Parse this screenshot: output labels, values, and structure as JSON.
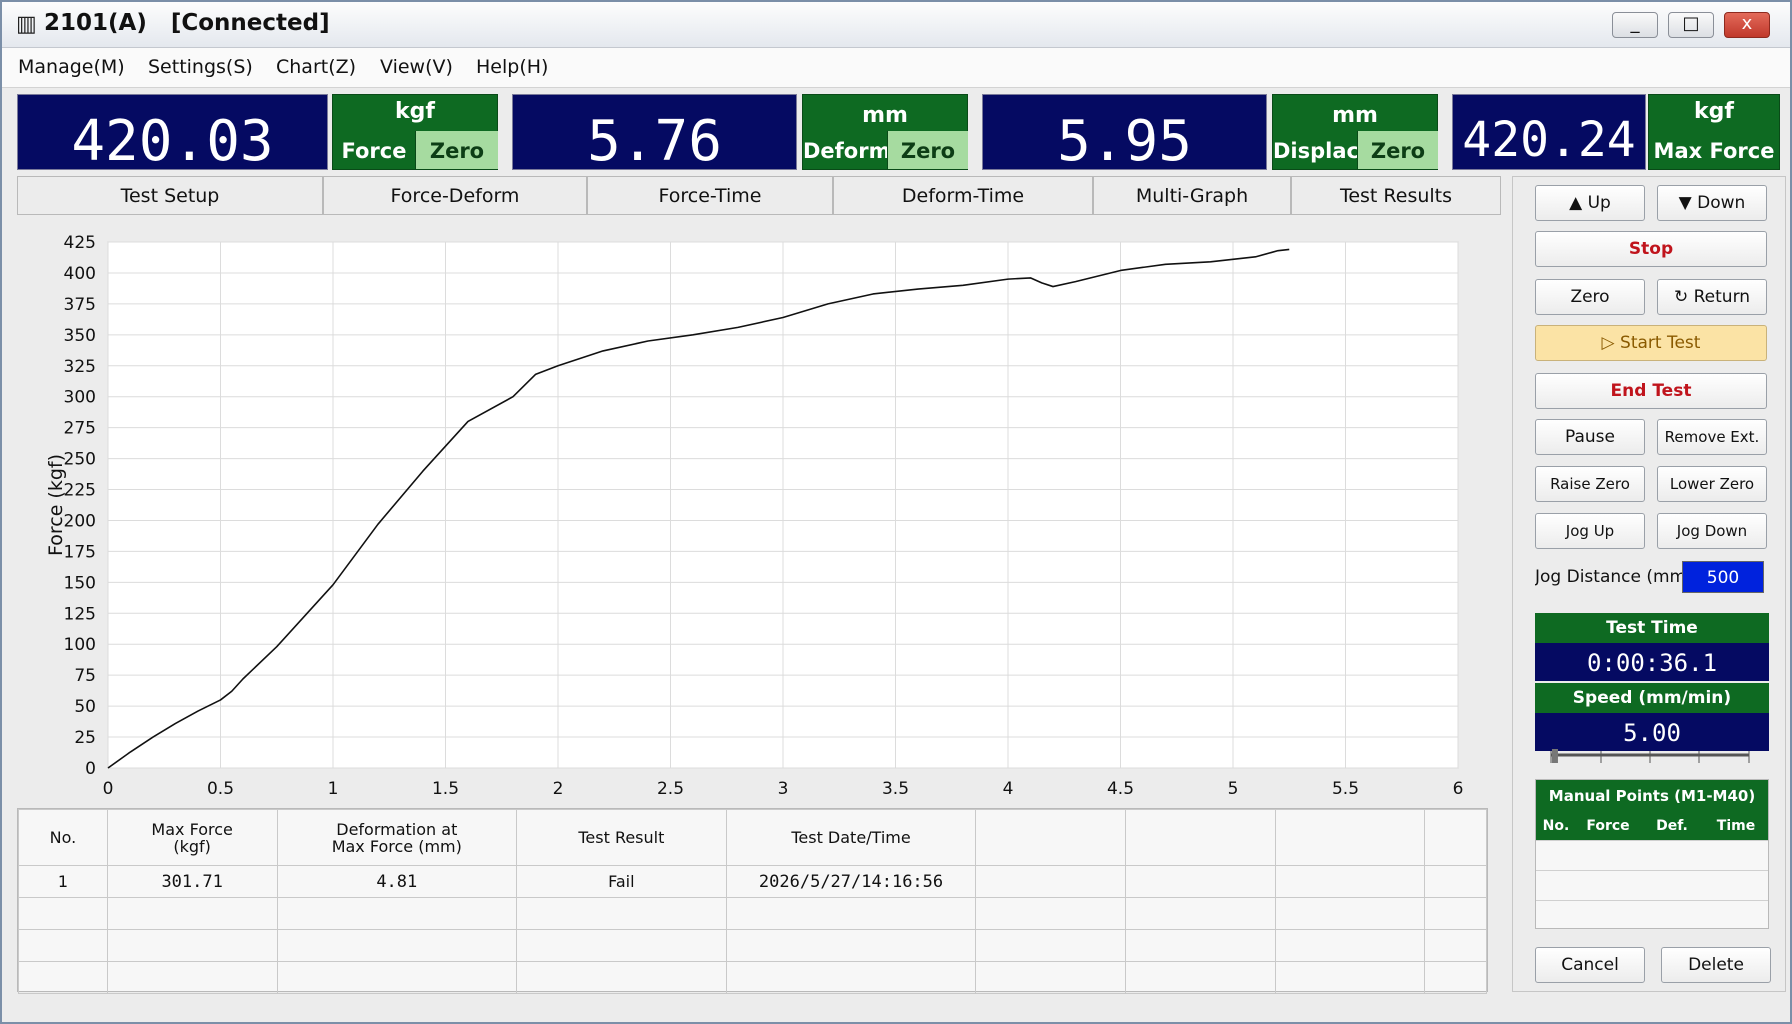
{
  "window": {
    "icon": "grid-icon",
    "title": "2101(A)   [Connected]",
    "minimize": "_",
    "maximize": "□",
    "close": "x"
  },
  "menu": [
    "Manage(M)",
    "Settings(S)",
    "Chart(Z)",
    "View(V)",
    "Help(H)"
  ],
  "readouts": {
    "force": {
      "value": "420.03",
      "unit": "kgf",
      "label": "Force",
      "zero": "Zero"
    },
    "deform": {
      "value": "5.76",
      "unit": "mm",
      "label": "Deform",
      "zero": "Zero"
    },
    "displace": {
      "value": "5.95",
      "unit": "mm",
      "label": "Displace",
      "zero": "Zero"
    },
    "maxforce": {
      "value": "420.24",
      "unit": "kgf",
      "label": "Max Force"
    }
  },
  "tabs": [
    "Test Setup",
    "Force-Deform",
    "Force-Time",
    "Deform-Time",
    "Multi-Graph",
    "Test Results"
  ],
  "chart_data": {
    "type": "line",
    "title": "",
    "xlabel": "",
    "ylabel": "Force (kgf)",
    "xlim": [
      0,
      6
    ],
    "ylim": [
      0,
      425
    ],
    "xticks": [
      "0",
      "0.5",
      "1",
      "1.5",
      "2",
      "2.5",
      "3",
      "3.5",
      "4",
      "4.5",
      "5",
      "5.5",
      "6"
    ],
    "yticks": [
      "0",
      "25",
      "50",
      "75",
      "100",
      "125",
      "150",
      "175",
      "200",
      "225",
      "250",
      "275",
      "300",
      "325",
      "350",
      "375",
      "400",
      "425"
    ],
    "grid": true,
    "series": [
      {
        "x": [
          0,
          0.1,
          0.2,
          0.3,
          0.4,
          0.5,
          0.55,
          0.6,
          0.75,
          0.9,
          1.0,
          1.2,
          1.4,
          1.6,
          1.8,
          1.9,
          2.0,
          2.2,
          2.4,
          2.6,
          2.8,
          3.0,
          3.2,
          3.4,
          3.6,
          3.8,
          4.0,
          4.1,
          4.15,
          4.2,
          4.3,
          4.5,
          4.7,
          4.9,
          5.1,
          5.2,
          5.25
        ],
        "y": [
          0,
          13,
          25,
          36,
          46,
          55,
          62,
          72,
          98,
          128,
          148,
          197,
          240,
          280,
          300,
          318,
          325,
          337,
          345,
          350,
          356,
          364,
          375,
          383,
          387,
          390,
          395,
          396,
          392,
          389,
          393,
          402,
          407,
          409,
          413,
          418,
          419
        ]
      }
    ]
  },
  "results": {
    "headers": [
      "No.",
      "Max Force\n(kgf)",
      "Deformation at\nMax Force (mm)",
      "Test Result",
      "Test Date/Time",
      "",
      "",
      "",
      ""
    ],
    "rows": [
      [
        "1",
        "301.71",
        "4.81",
        "Fail",
        "2026/5/27/14:16:56",
        "",
        "",
        "",
        ""
      ]
    ]
  },
  "controls": {
    "up": "▲ Up",
    "down": "▼ Down",
    "stop": "Stop",
    "zero": "Zero",
    "return": "↻ Return",
    "start": "▷ Start Test",
    "end": "End Test",
    "pause": "Pause",
    "remove_ext": "Remove Ext.",
    "raise_zero": "Raise Zero",
    "lower_zero": "Lower Zero",
    "jog_up": "Jog Up",
    "jog_down": "Jog Down",
    "jog_label": "Jog Distance (mm",
    "jog_value": "500",
    "test_time_label": "Test Time",
    "test_time": "0:00:36.1",
    "speed_label": "Speed (mm/min)",
    "speed": "5.00",
    "speed_fraction": 0.02,
    "manual_points_title": "Manual Points (M1-M40)",
    "manual_cols": [
      "No.",
      "Force",
      "Def.",
      "Time"
    ],
    "cancel": "Cancel",
    "delete": "Delete"
  }
}
